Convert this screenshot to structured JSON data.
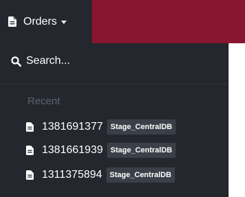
{
  "header": {
    "menu_label": "Orders",
    "menu_icon": "document-icon",
    "caret_icon": "caret-down-icon",
    "brand_color": "#8a1530"
  },
  "dropdown": {
    "search_label": "Search...",
    "search_icon": "search-icon",
    "recent_heading": "Recent",
    "items": [
      {
        "order_id": "1381691377",
        "environment": "Stage_CentralDB"
      },
      {
        "order_id": "1381661939",
        "environment": "Stage_CentralDB"
      },
      {
        "order_id": "1311375894",
        "environment": "Stage_CentralDB"
      }
    ],
    "background": "#24282e"
  }
}
